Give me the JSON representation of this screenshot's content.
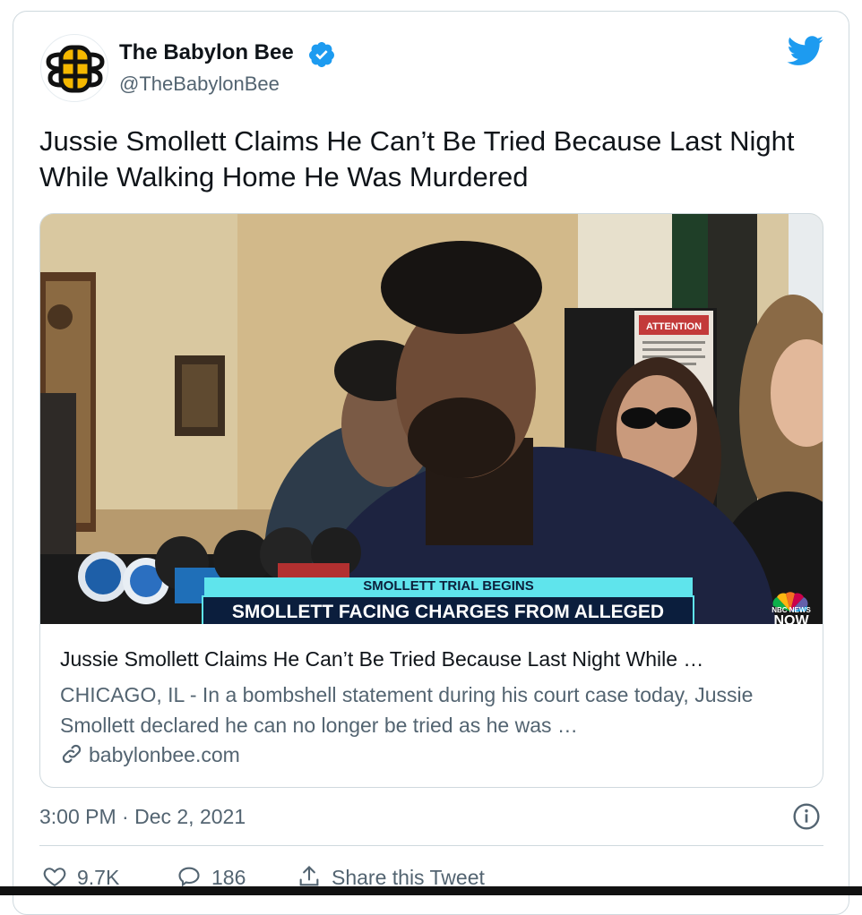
{
  "author": {
    "name": "The Babylon Bee",
    "handle": "@TheBabylonBee",
    "verified": true
  },
  "tweet": {
    "text": "Jussie Smollett Claims He Can’t Be Tried Because Last Night While Walking Home He Was Murdered",
    "timestamp": "3:00 PM · Dec 2, 2021"
  },
  "link_card": {
    "title": "Jussie Smollett Claims He Can’t Be Tried Because Last Night While …",
    "description": "CHICAGO, IL - In a bombshell statement during his court case today, Jussie Smollett declared he can no longer be tried as he was …",
    "domain": "babylonbee.com",
    "media": {
      "overlay_small": "SMOLLETT TRIAL BEGINS",
      "overlay_big": "SMOLLETT FACING CHARGES FROM ALLEGED ASSAULT",
      "sign_text": "ATTENTION",
      "network_small": "NBC NEWS",
      "network_big": "NOW"
    }
  },
  "actions": {
    "likes": "9.7K",
    "replies": "186",
    "share_label": "Share this Tweet"
  },
  "colors": {
    "twitter_blue": "#1d9bf0",
    "text_primary": "#0f1419",
    "text_secondary": "#536471",
    "border": "#cfd9de",
    "chyron_cyan": "#5fe4ec",
    "chyron_navy": "#0b1e3d"
  },
  "icons": [
    "babylon-bee-logo",
    "verified-badge-icon",
    "twitter-bird-icon",
    "link-icon",
    "info-icon",
    "heart-icon",
    "reply-icon",
    "share-icon"
  ]
}
